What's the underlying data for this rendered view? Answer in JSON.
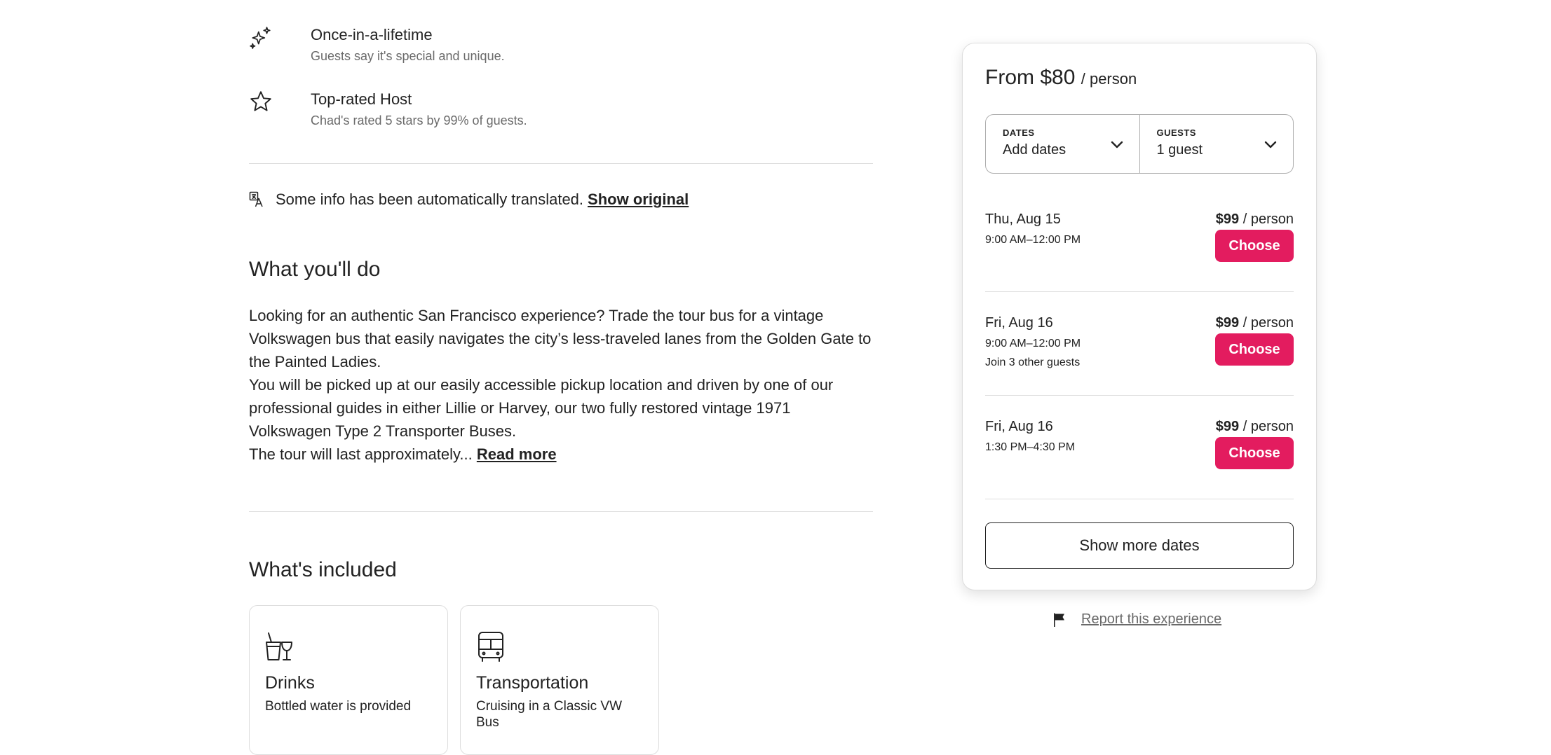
{
  "highlights": [
    {
      "icon": "sparkles-icon",
      "title": "Once-in-a-lifetime",
      "subtitle": "Guests say it's special and unique."
    },
    {
      "icon": "star-icon",
      "title": "Top-rated Host",
      "subtitle": "Chad's rated 5 stars by 99% of guests."
    }
  ],
  "translation": {
    "notice": "Some info has been automatically translated.",
    "link": "Show original"
  },
  "about": {
    "heading": "What you'll do",
    "paragraphs": [
      "Looking for an authentic San Francisco experience? Trade the tour bus for a vintage Volkswagen bus that easily navigates the city’s less-traveled lanes from the Golden Gate to the Painted Ladies.",
      "You will be picked up at our easily accessible pickup location and driven by one of our professional guides in either Lillie or Harvey, our two fully restored vintage 1971 Volkswagen Type 2 Transporter Buses.",
      "The tour will last approximately..."
    ],
    "read_more": "Read more"
  },
  "included": {
    "heading": "What's included",
    "items": [
      {
        "icon": "drinks-icon",
        "title": "Drinks",
        "description": "Bottled water is provided"
      },
      {
        "icon": "bus-icon",
        "title": "Transportation",
        "description": "Cruising in a Classic VW Bus"
      }
    ]
  },
  "booking": {
    "price_from": "From $80",
    "per_unit": "/ person",
    "dates": {
      "label": "DATES",
      "value": "Add dates"
    },
    "guests": {
      "label": "GUESTS",
      "value": "1 guest"
    },
    "slots": [
      {
        "date": "Thu, Aug 15",
        "time": "9:00 AM–12:00 PM",
        "note": "",
        "price": "$99",
        "per": "/ person",
        "button": "Choose"
      },
      {
        "date": "Fri, Aug 16",
        "time": "9:00 AM–12:00 PM",
        "note": "Join 3 other guests",
        "price": "$99",
        "per": "/ person",
        "button": "Choose"
      },
      {
        "date": "Fri, Aug 16",
        "time": "1:30 PM–4:30 PM",
        "note": "",
        "price": "$99",
        "per": "/ person",
        "button": "Choose"
      }
    ],
    "show_more": "Show more dates"
  },
  "report": {
    "label": "Report this experience"
  },
  "colors": {
    "accent": "#e31c5f",
    "text": "#222222",
    "muted": "#6a6a6a",
    "border": "#dddddd"
  }
}
